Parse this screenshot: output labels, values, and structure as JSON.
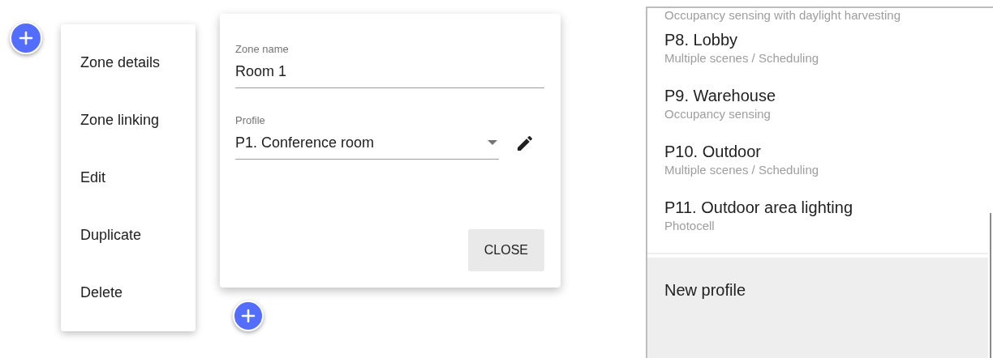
{
  "menu": {
    "items": [
      {
        "label": "Zone details"
      },
      {
        "label": "Zone linking"
      },
      {
        "label": "Edit"
      },
      {
        "label": "Duplicate"
      },
      {
        "label": "Delete"
      }
    ]
  },
  "dialog": {
    "zone_name": {
      "label": "Zone name",
      "value": "Room 1"
    },
    "profile": {
      "label": "Profile",
      "value": "P1. Conference room"
    },
    "close_button": "CLOSE"
  },
  "profile_list": {
    "partial_subtitle": "Occupancy sensing with daylight harvesting",
    "items": [
      {
        "title": "P8. Lobby",
        "subtitle": "Multiple scenes / Scheduling"
      },
      {
        "title": "P9. Warehouse",
        "subtitle": "Occupancy sensing"
      },
      {
        "title": "P10. Outdoor",
        "subtitle": "Multiple scenes / Scheduling"
      },
      {
        "title": "P11. Outdoor area lighting",
        "subtitle": "Photocell"
      }
    ],
    "new_profile": {
      "label": "New profile",
      "selected": true
    }
  }
}
